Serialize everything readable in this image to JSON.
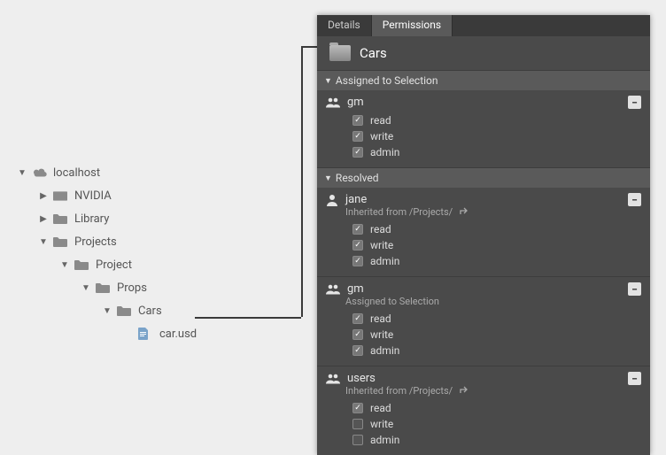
{
  "tree": {
    "root": {
      "label": "localhost"
    },
    "nodes": [
      {
        "label": "NVIDIA",
        "expanded": false,
        "depth": 1,
        "icon": "drive"
      },
      {
        "label": "Library",
        "expanded": false,
        "depth": 1,
        "icon": "folder"
      },
      {
        "label": "Projects",
        "expanded": true,
        "depth": 1,
        "icon": "folder"
      },
      {
        "label": "Project",
        "expanded": true,
        "depth": 2,
        "icon": "folder"
      },
      {
        "label": "Props",
        "expanded": true,
        "depth": 3,
        "icon": "folder"
      },
      {
        "label": "Cars",
        "expanded": true,
        "depth": 4,
        "icon": "folder"
      },
      {
        "label": "car.usd",
        "expanded": null,
        "depth": 5,
        "icon": "file"
      }
    ]
  },
  "tabs": {
    "details": "Details",
    "permissions": "Permissions",
    "active": "permissions"
  },
  "panel": {
    "title": "Cars"
  },
  "sections": {
    "assigned": "Assigned to Selection",
    "resolved": "Resolved"
  },
  "perm_labels": {
    "read": "read",
    "write": "write",
    "admin": "admin"
  },
  "assigned": [
    {
      "kind": "group",
      "name": "gm",
      "sub": null,
      "perms": {
        "read": true,
        "write": true,
        "admin": true
      }
    }
  ],
  "resolved": [
    {
      "kind": "user",
      "name": "jane",
      "sub": "Inherited from /Projects/",
      "link_icon": true,
      "perms": {
        "read": true,
        "write": true,
        "admin": true
      }
    },
    {
      "kind": "group",
      "name": "gm",
      "sub": "Assigned to Selection",
      "link_icon": false,
      "perms": {
        "read": true,
        "write": true,
        "admin": true
      }
    },
    {
      "kind": "group",
      "name": "users",
      "sub": "Inherited from /Projects/",
      "link_icon": true,
      "perms": {
        "read": true,
        "write": false,
        "admin": false
      }
    }
  ]
}
